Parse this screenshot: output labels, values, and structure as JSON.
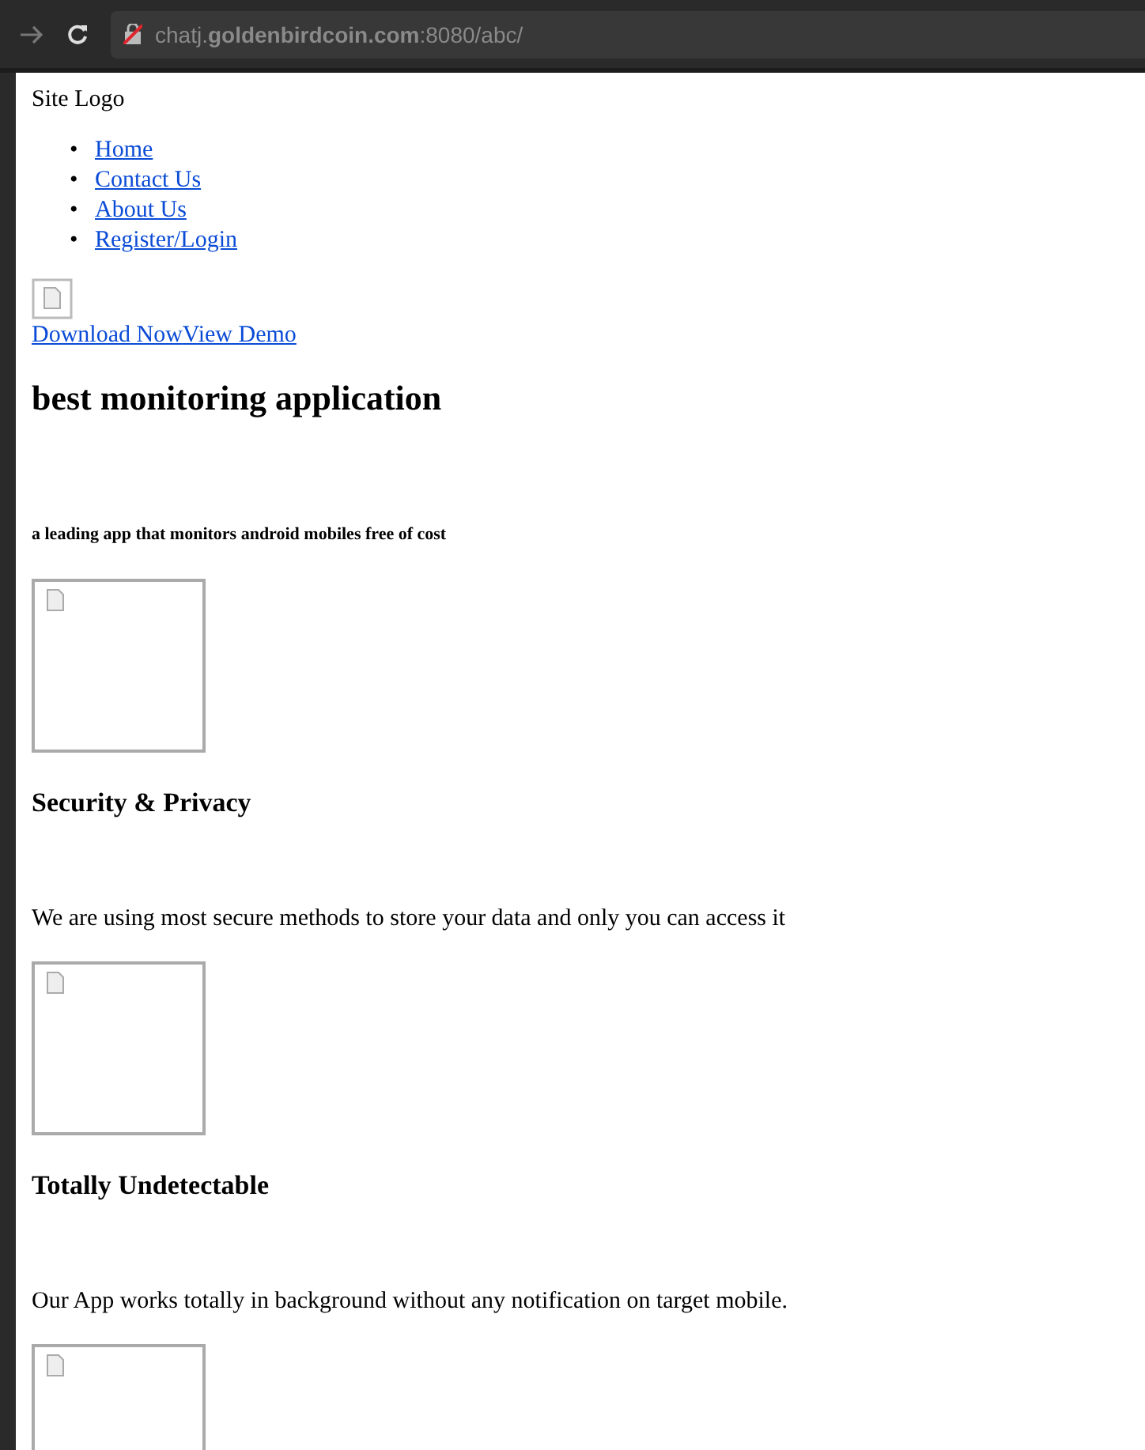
{
  "browser": {
    "url": "chatj.**goldenbirdcoin.com**:8080/abc/"
  },
  "page": {
    "logo": "Site Logo",
    "nav": [
      {
        "bullet": "•",
        "label": "Home"
      },
      {
        "bullet": "•",
        "label": "Contact Us"
      },
      {
        "bullet": "•",
        "label": "About Us"
      },
      {
        "bullet": "•",
        "label": "Register/Login"
      }
    ],
    "links": [
      "Download Now",
      "View Demo"
    ],
    "heading": "best monitoring application",
    "tagline": "a leading app that monitors android mobiles free of cost",
    "features": [
      {
        "kind": "broken-image",
        "title": "Security & Privacy",
        "text": "We are using most secure methods to store your data and only you can access it"
      },
      {
        "kind": "broken-image",
        "title": "Totally Undetectable",
        "text": "Our App works totally in background without any notification on target mobile."
      },
      {
        "kind": "broken-image"
      }
    ]
  }
}
